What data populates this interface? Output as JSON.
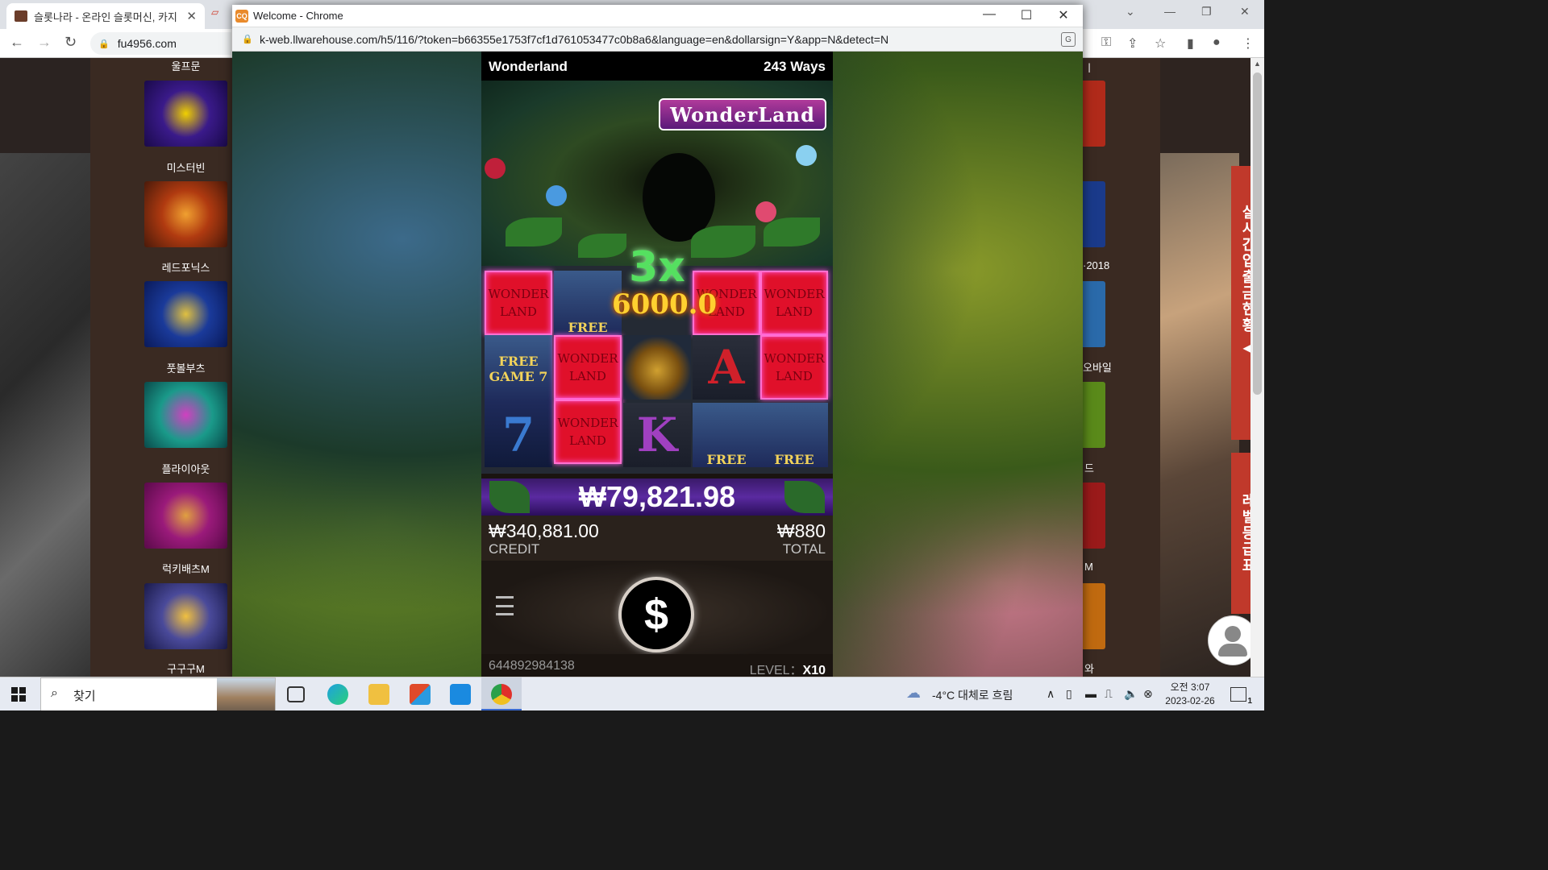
{
  "background_browser": {
    "tab_title": "슬롯나라 - 온라인 슬롯머신, 카지",
    "address": "fu4956.com",
    "games_left": [
      {
        "name": "울프문",
        "color": "#3a1a6a"
      },
      {
        "name": "미스터빈",
        "color": "#3a1a8a"
      },
      {
        "name": "레드포닉스",
        "color": "#b03a10"
      },
      {
        "name": "풋볼부츠",
        "color": "#1a3a9a"
      },
      {
        "name": "플라이아웃",
        "color": "#1a9a8a"
      },
      {
        "name": "럭키배츠M",
        "color": "#9a1a7a"
      },
      {
        "name": "구구구M",
        "color": "#4a4a9a"
      }
    ],
    "games_right_partial": [
      "ㅣ",
      "·2018",
      "오바일",
      "드",
      "M",
      "와"
    ],
    "side_banner_realtime": "실시간입출금현황",
    "side_banner_level": "레벨등급표"
  },
  "popup": {
    "window_title": "Welcome - Chrome",
    "favicon_text": "CQ",
    "url": "k-web.llwarehouse.com/h5/116/?token=b66355e1753f7cf1d761053477c0b8a6&language=en&dollarsign=Y&app=N&detect=N"
  },
  "game": {
    "name": "Wonderland",
    "ways": "243 Ways",
    "logo": "WonderLand",
    "reels": [
      [
        "WONDER LAND",
        "FREE",
        "WONDER LAND",
        "WONDER LAND"
      ],
      [
        "FREE GAME 7",
        "WONDER LAND",
        "",
        "A",
        "WONDER LAND"
      ],
      [
        "WONDER LAND",
        "K",
        "FREE",
        "FREE"
      ]
    ],
    "multiplier": "3x",
    "multiplier_win": "6000.0",
    "win_amount": "₩79,821.98",
    "credit_value": "₩340,881.00",
    "credit_label": "CREDIT",
    "total_value": "₩880",
    "total_label": "TOTAL",
    "spin_symbol": "$",
    "round_id": "644892984138",
    "level_label": "LEVEL：",
    "level_value": "X10"
  },
  "taskbar": {
    "search_placeholder": "찾기",
    "weather": "-4°C  대체로 흐림",
    "time": "오전 3:07",
    "date": "2023-02-26",
    "notifications": "1"
  }
}
